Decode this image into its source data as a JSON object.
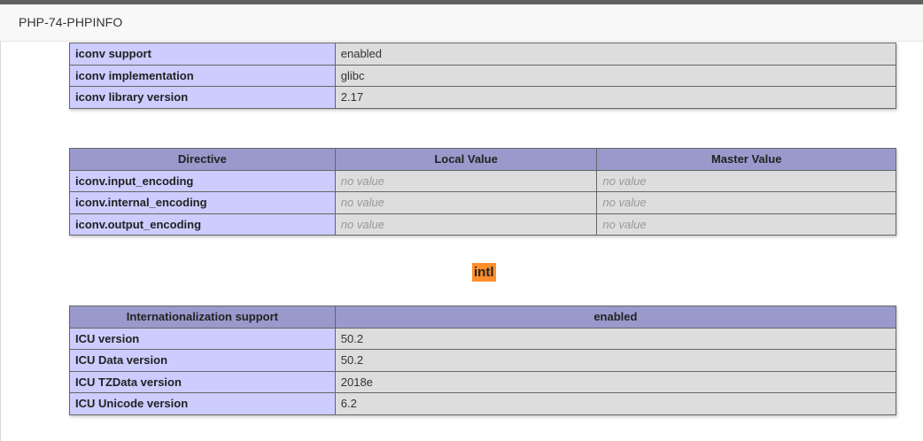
{
  "window": {
    "title": "PHP-74-PHPINFO"
  },
  "iconv_table": {
    "rows": [
      {
        "name": "iconv support",
        "value": "enabled"
      },
      {
        "name": "iconv implementation",
        "value": "glibc"
      },
      {
        "name": "iconv library version",
        "value": "2.17"
      }
    ]
  },
  "iconv_directives": {
    "headers": [
      "Directive",
      "Local Value",
      "Master Value"
    ],
    "rows": [
      {
        "name": "iconv.input_encoding",
        "local": "no value",
        "master": "no value"
      },
      {
        "name": "iconv.internal_encoding",
        "local": "no value",
        "master": "no value"
      },
      {
        "name": "iconv.output_encoding",
        "local": "no value",
        "master": "no value"
      }
    ]
  },
  "intl_section": {
    "heading": "intl"
  },
  "intl_table": {
    "headers": [
      "Internationalization support",
      "enabled"
    ],
    "rows": [
      {
        "name": "ICU version",
        "value": "50.2"
      },
      {
        "name": "ICU Data version",
        "value": "50.2"
      },
      {
        "name": "ICU TZData version",
        "value": "2018e"
      },
      {
        "name": "ICU Unicode version",
        "value": "6.2"
      }
    ]
  }
}
